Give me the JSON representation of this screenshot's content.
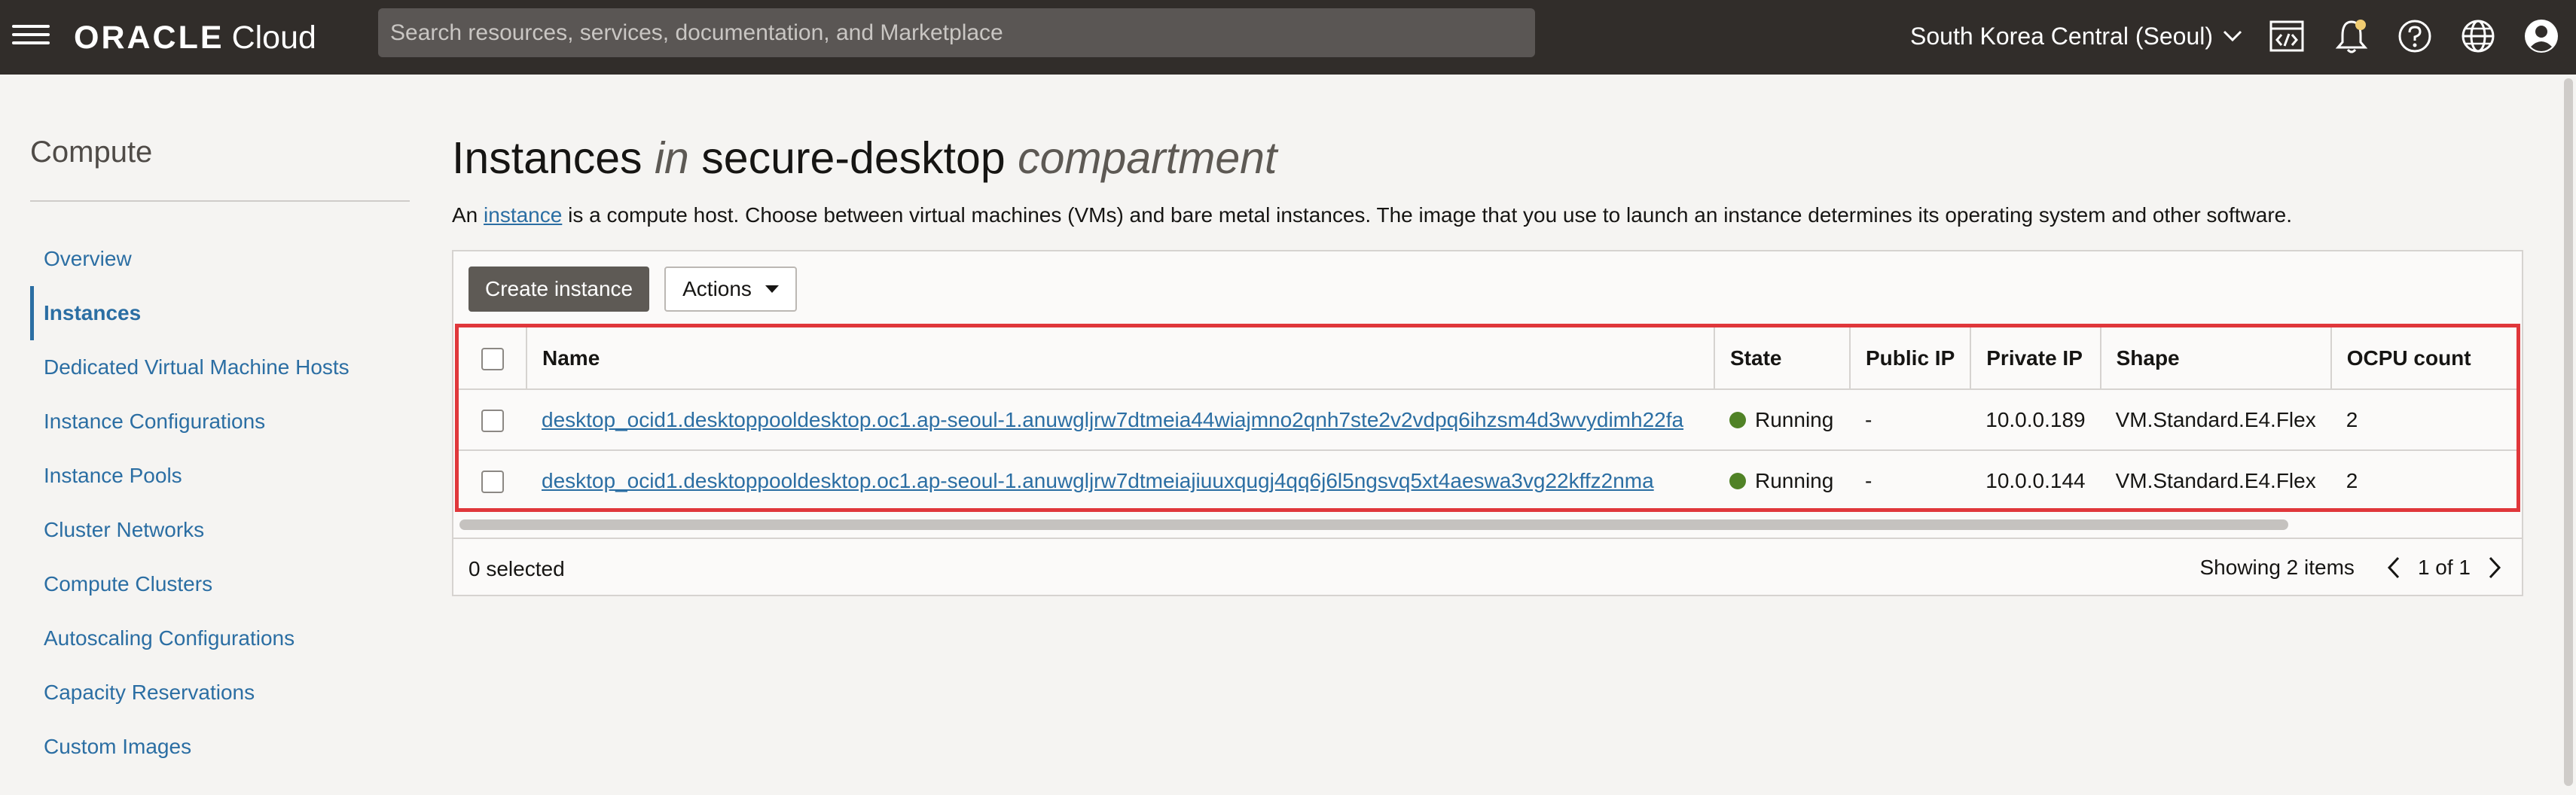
{
  "header": {
    "brand_oracle": "ORACLE",
    "brand_cloud": "Cloud",
    "search_placeholder": "Search resources, services, documentation, and Marketplace",
    "region": "South Korea Central (Seoul)",
    "icons": [
      "hamburger-icon",
      "cloud-shell-icon",
      "bell-icon",
      "help-icon",
      "globe-icon",
      "user-icon"
    ],
    "bell_badge_color": "#f0cc71"
  },
  "sidebar": {
    "title": "Compute",
    "items": [
      {
        "label": "Overview"
      },
      {
        "label": "Instances",
        "active": true
      },
      {
        "label": "Dedicated Virtual Machine Hosts"
      },
      {
        "label": "Instance Configurations"
      },
      {
        "label": "Instance Pools"
      },
      {
        "label": "Cluster Networks"
      },
      {
        "label": "Compute Clusters"
      },
      {
        "label": "Autoscaling Configurations"
      },
      {
        "label": "Capacity Reservations"
      },
      {
        "label": "Custom Images"
      }
    ]
  },
  "main": {
    "title_part1": "Instances",
    "title_in": "in",
    "title_compartment": "secure-desktop",
    "title_suffix": "compartment",
    "desc_prefix": "An",
    "desc_link": "instance",
    "desc_suffix": "is a compute host. Choose between virtual machines (VMs) and bare metal instances. The image that you use to launch an instance determines its operating system and other software.",
    "create_button": "Create instance",
    "actions_button": "Actions",
    "table": {
      "columns": [
        "Name",
        "State",
        "Public IP",
        "Private IP",
        "Shape",
        "OCPU count"
      ],
      "rows": [
        {
          "name": "desktop_ocid1.desktoppooldesktop.oc1.ap-seoul-1.anuwgljrw7dtmeia44wiajmno2qnh7ste2v2vdpq6ihzsm4d3wvydimh22fa",
          "state": "Running",
          "public_ip": "-",
          "private_ip": "10.0.0.189",
          "shape": "VM.Standard.E4.Flex",
          "ocpu": "2"
        },
        {
          "name": "desktop_ocid1.desktoppooldesktop.oc1.ap-seoul-1.anuwgljrw7dtmeiajiuuxqugj4qq6j6l5ngsvq5xt4aeswa3vg22kffz2nma",
          "state": "Running",
          "public_ip": "-",
          "private_ip": "10.0.0.144",
          "shape": "VM.Standard.E4.Flex",
          "ocpu": "2"
        }
      ]
    },
    "selected_count": "0 selected",
    "showing": "Showing 2 items",
    "page": "1 of 1",
    "colors": {
      "highlight": "#e0373b",
      "running": "#508226",
      "link": "#2b6ea3"
    }
  }
}
